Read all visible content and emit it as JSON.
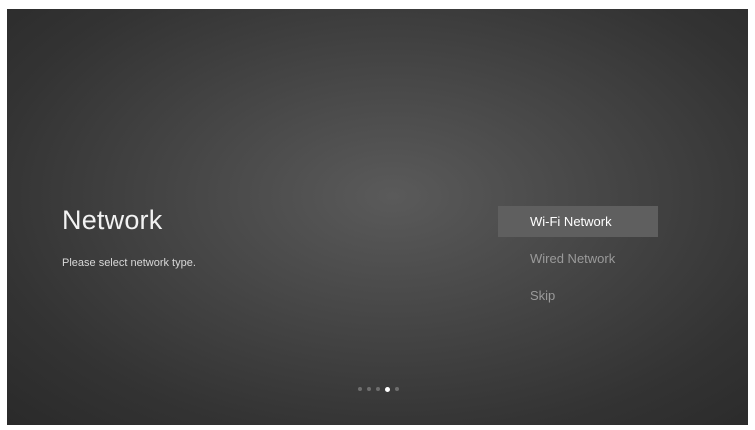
{
  "screen": {
    "title": "Network",
    "subtitle": "Please select network type."
  },
  "menu": {
    "items": [
      {
        "label": "Wi-Fi Network",
        "selected": true
      },
      {
        "label": "Wired Network",
        "selected": false
      },
      {
        "label": "Skip",
        "selected": false
      }
    ]
  },
  "pager": {
    "total_steps": 5,
    "current_step": 4
  },
  "colors": {
    "background": "#4a4a4a",
    "selected_item_bg": "#5f5f5f",
    "text_primary": "#ffffff",
    "text_dim": "#9a9a9a"
  }
}
